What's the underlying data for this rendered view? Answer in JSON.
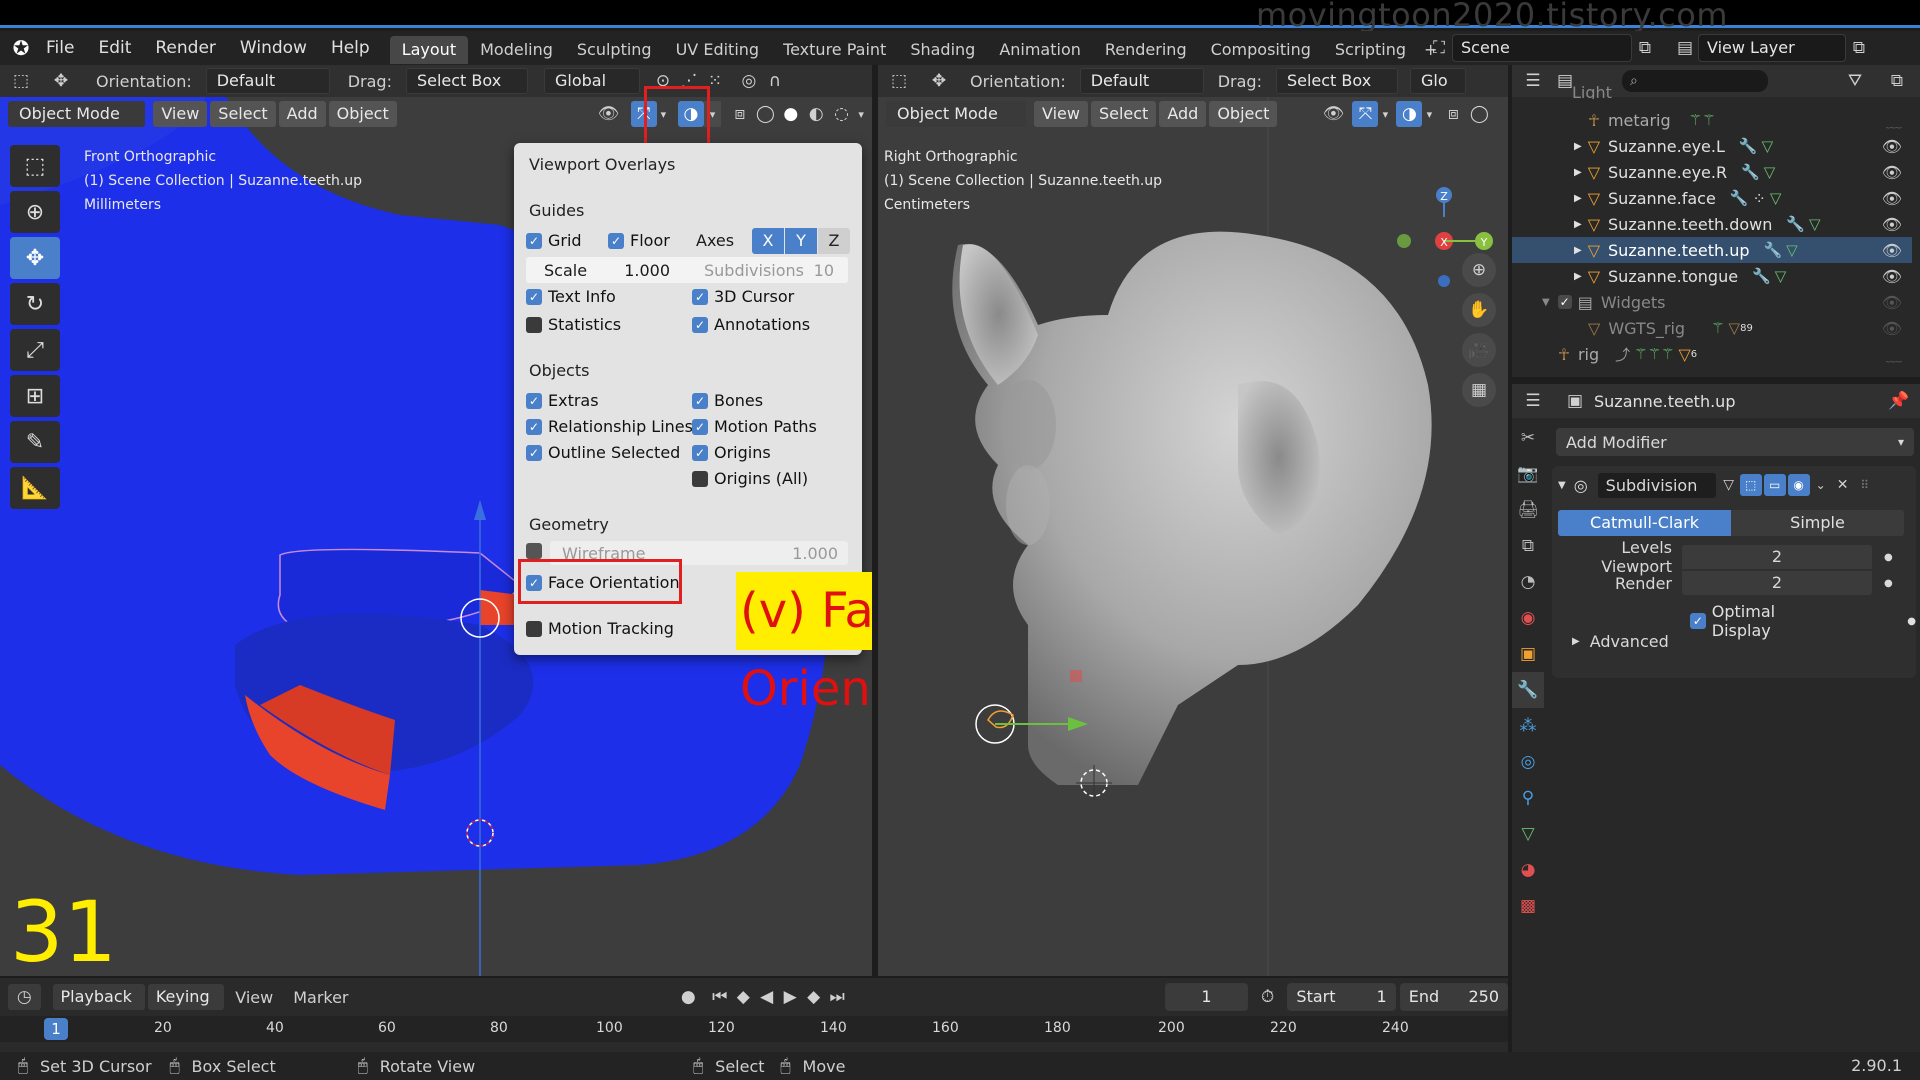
{
  "watermark": "movingtoon2020.tistory.com",
  "menubar": {
    "items": [
      "File",
      "Edit",
      "Render",
      "Window",
      "Help"
    ],
    "workspaces": [
      "Layout",
      "Modeling",
      "Sculpting",
      "UV Editing",
      "Texture Paint",
      "Shading",
      "Animation",
      "Rendering",
      "Compositing",
      "Scripting"
    ],
    "active_workspace": "Layout",
    "add_tab": "+",
    "scene": "Scene",
    "view_layer": "View Layer"
  },
  "left_viewport": {
    "orientation_label": "Orientation:",
    "orientation_value": "Default",
    "drag_label": "Drag:",
    "drag_value": "Select Box",
    "transform": "Global",
    "mode": "Object Mode",
    "menus": [
      "View",
      "Select",
      "Add",
      "Object"
    ],
    "info_view": "Front Orthographic",
    "info_collection": "(1) Scene Collection | Suzanne.teeth.up",
    "info_units": "Millimeters"
  },
  "right_viewport": {
    "orientation_label": "Orientation:",
    "orientation_value": "Default",
    "drag_label": "Drag:",
    "drag_value": "Select Box",
    "transform": "Glo",
    "mode": "Object Mode",
    "menus": [
      "View",
      "Select",
      "Add",
      "Object"
    ],
    "info_view": "Right Orthographic",
    "info_collection": "(1) Scene Collection | Suzanne.teeth.up",
    "info_units": "Centimeters"
  },
  "overlay_popup": {
    "title": "Viewport Overlays",
    "guides_heading": "Guides",
    "grid": "Grid",
    "floor": "Floor",
    "axes": "Axes",
    "axis_x": "X",
    "axis_y": "Y",
    "axis_z": "Z",
    "scale_label": "Scale",
    "scale_value": "1.000",
    "subdivisions_label": "Subdivisions",
    "subdivisions_value": "10",
    "text_info": "Text Info",
    "cursor_3d": "3D Cursor",
    "statistics": "Statistics",
    "annotations": "Annotations",
    "objects_heading": "Objects",
    "extras": "Extras",
    "bones": "Bones",
    "relationship_lines": "Relationship Lines",
    "motion_paths": "Motion Paths",
    "outline_selected": "Outline Selected",
    "origins": "Origins",
    "origins_all": "Origins (All)",
    "geometry_heading": "Geometry",
    "wireframe": "Wireframe",
    "wireframe_value": "1.000",
    "face_orientation": "Face Orientation",
    "motion_tracking": "Motion Tracking"
  },
  "callout": "(v) Face Orientation",
  "frame_badge": "31",
  "outliner": {
    "rows": [
      {
        "name": "Light",
        "selected": false
      },
      {
        "name": "metarig",
        "selected": false
      },
      {
        "name": "Suzanne.eye.L",
        "selected": false
      },
      {
        "name": "Suzanne.eye.R",
        "selected": false
      },
      {
        "name": "Suzanne.face",
        "selected": false
      },
      {
        "name": "Suzanne.teeth.down",
        "selected": false
      },
      {
        "name": "Suzanne.teeth.up",
        "selected": true
      },
      {
        "name": "Suzanne.tongue",
        "selected": false
      },
      {
        "name": "Widgets",
        "selected": false
      },
      {
        "name": "WGTS_rig",
        "selected": false
      },
      {
        "name": "rig",
        "selected": false
      }
    ],
    "badge_89": "89",
    "badge_6": "6"
  },
  "properties": {
    "object_name": "Suzanne.teeth.up",
    "add_modifier": "Add Modifier",
    "modifier_name": "Subdivision",
    "catmull_clark": "Catmull-Clark",
    "simple": "Simple",
    "levels_viewport_label": "Levels Viewport",
    "levels_viewport_value": "2",
    "render_label": "Render",
    "render_value": "2",
    "optimal_display": "Optimal Display",
    "advanced": "Advanced"
  },
  "timeline": {
    "playback": "Playback",
    "keying": "Keying",
    "view": "View",
    "marker": "Marker",
    "current_frame": "1",
    "start_label": "Start",
    "start_value": "1",
    "end_label": "End",
    "end_value": "250",
    "ruler": [
      "1",
      "20",
      "40",
      "60",
      "80",
      "100",
      "120",
      "140",
      "160",
      "180",
      "200",
      "220",
      "240"
    ]
  },
  "statusbar": {
    "set_cursor": "Set 3D Cursor",
    "box_select": "Box Select",
    "rotate_view": "Rotate View",
    "select": "Select",
    "move": "Move",
    "version": "2.90.1"
  },
  "colors": {
    "accent": "#4a7fc9",
    "highlight_red": "#e02020",
    "callout_bg": "#ffee00",
    "callout_text": "#e01010",
    "face_front": "#1d2fe8",
    "face_back": "#e8432b"
  }
}
